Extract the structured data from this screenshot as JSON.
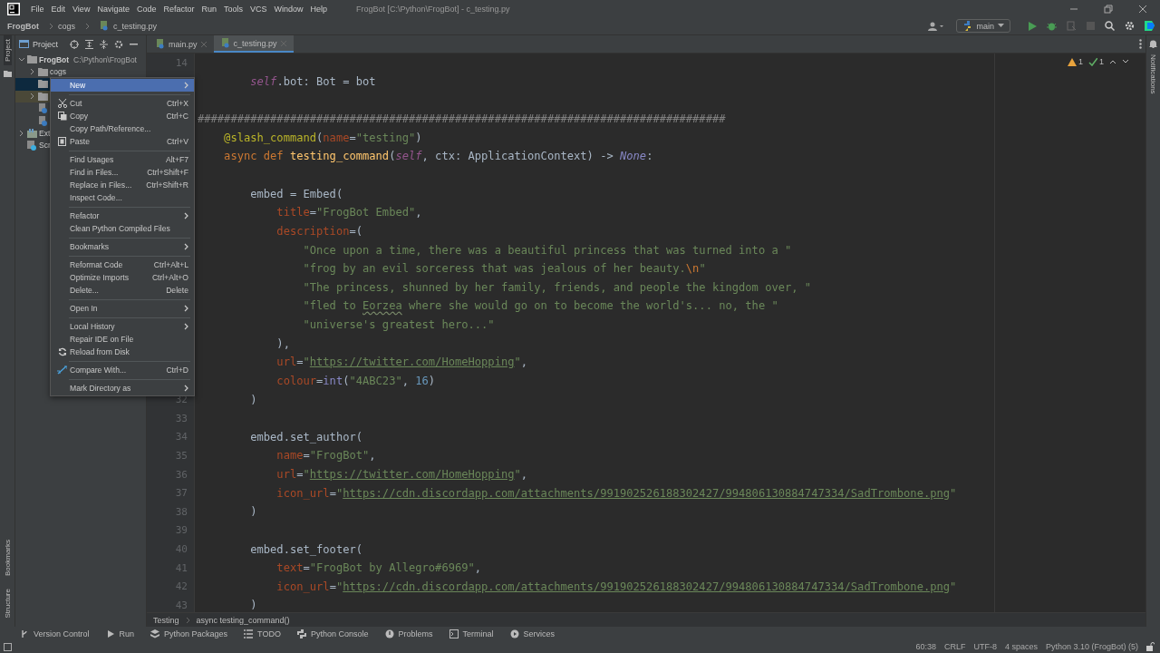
{
  "menu_bar": [
    "File",
    "Edit",
    "View",
    "Navigate",
    "Code",
    "Refactor",
    "Run",
    "Tools",
    "VCS",
    "Window",
    "Help"
  ],
  "window": {
    "title": "FrogBot [C:\\Python\\FrogBot] - c_testing.py"
  },
  "breadcrumbs": [
    {
      "label": "FrogBot",
      "kind": "project"
    },
    {
      "label": "cogs",
      "kind": "folder"
    },
    {
      "label": "c_testing.py",
      "kind": "file"
    }
  ],
  "run_config": {
    "label": "main"
  },
  "left_strip": {
    "top": [
      {
        "label": "Project",
        "selected": true
      }
    ],
    "bottom": [
      {
        "label": "Bookmarks",
        "selected": false
      },
      {
        "label": "Structure",
        "selected": false
      }
    ]
  },
  "right_strip": [
    {
      "label": "Notifications",
      "selected": false
    }
  ],
  "project_panel": {
    "title": "Project",
    "tree": [
      {
        "kind": "folder",
        "label": "FrogBot",
        "path": "C:\\Python\\FrogBot",
        "expanded": true,
        "selected": false,
        "children": [
          {
            "kind": "folder",
            "label": "cogs",
            "expanded": false,
            "selected": false
          },
          {
            "kind": "folder",
            "selected": true
          },
          {
            "kind": "folder",
            "expanded": false,
            "selected": false,
            "highlighted": true
          },
          {
            "kind": "file",
            "selected": false
          },
          {
            "kind": "file",
            "selected": false
          }
        ]
      },
      {
        "kind": "library",
        "label": "Ext",
        "expanded": false,
        "selected": false
      },
      {
        "kind": "scratch",
        "label": "Scr",
        "selected": false
      }
    ]
  },
  "tabs": [
    {
      "label": "main.py",
      "selected": false
    },
    {
      "label": "c_testing.py",
      "selected": true
    }
  ],
  "inspections": {
    "warnings": "1",
    "checks": "1"
  },
  "code_lines": [
    {
      "number": "14",
      "kind": "blank"
    },
    {
      "kind": "code",
      "tokens": [
        {
          "kind": "self",
          "text": "        self"
        },
        {
          "kind": "plain",
          "text": ".bot: Bot = bot"
        }
      ]
    },
    {
      "kind": "blank"
    },
    {
      "kind": "code",
      "tokens": [
        {
          "kind": "comment",
          "text": "################################################################################"
        }
      ]
    },
    {
      "kind": "code",
      "tokens": [
        {
          "kind": "deco",
          "text": "    @slash_command"
        },
        {
          "kind": "plain",
          "text": "("
        },
        {
          "kind": "param",
          "text": "name"
        },
        {
          "kind": "plain",
          "text": "="
        },
        {
          "kind": "str",
          "text": "\"testing\""
        },
        {
          "kind": "plain",
          "text": ")"
        }
      ]
    },
    {
      "kind": "code",
      "tokens": [
        {
          "kind": "kw",
          "text": "    async def "
        },
        {
          "kind": "func",
          "text": "testing_command"
        },
        {
          "kind": "plain",
          "text": "("
        },
        {
          "kind": "self",
          "text": "self"
        },
        {
          "kind": "plain",
          "text": ", ctx: ApplicationContext) -> "
        },
        {
          "kind": "none",
          "text": "None"
        },
        {
          "kind": "plain",
          "text": ":"
        }
      ]
    },
    {
      "kind": "blank"
    },
    {
      "kind": "code",
      "tokens": [
        {
          "kind": "plain",
          "text": "        embed = "
        },
        {
          "kind": "cls",
          "text": "Embed"
        },
        {
          "kind": "plain",
          "text": "("
        }
      ]
    },
    {
      "kind": "code",
      "tokens": [
        {
          "kind": "param",
          "text": "            title"
        },
        {
          "kind": "plain",
          "text": "="
        },
        {
          "kind": "str",
          "text": "\"FrogBot Embed\""
        },
        {
          "kind": "plain",
          "text": ","
        }
      ]
    },
    {
      "kind": "code",
      "tokens": [
        {
          "kind": "param",
          "text": "            description"
        },
        {
          "kind": "plain",
          "text": "=("
        }
      ]
    },
    {
      "kind": "code",
      "tokens": [
        {
          "kind": "str",
          "text": "                \"Once upon a time, there was a beautiful princess that was turned into a \""
        }
      ]
    },
    {
      "kind": "code",
      "tokens": [
        {
          "kind": "str",
          "text": "                \"frog by an evil sorceress that was jealous of her beauty."
        },
        {
          "kind": "esc",
          "text": "\\n"
        },
        {
          "kind": "str",
          "text": "\""
        }
      ]
    },
    {
      "kind": "code",
      "tokens": [
        {
          "kind": "str",
          "text": "                \"The princess, shunned by her family, friends, and people the kingdom over, \""
        }
      ]
    },
    {
      "kind": "code",
      "tokens": [
        {
          "kind": "str",
          "text": "                \"fled to "
        },
        {
          "kind": "typo",
          "text": "Eorzea"
        },
        {
          "kind": "str",
          "text": " where she would go on to become the world's... no, the \""
        }
      ]
    },
    {
      "kind": "code",
      "tokens": [
        {
          "kind": "str",
          "text": "                \"universe's greatest hero...\""
        }
      ]
    },
    {
      "kind": "code",
      "tokens": [
        {
          "kind": "plain",
          "text": "            ),"
        }
      ]
    },
    {
      "kind": "code",
      "tokens": [
        {
          "kind": "param",
          "text": "            url"
        },
        {
          "kind": "plain",
          "text": "="
        },
        {
          "kind": "str",
          "text": "\""
        },
        {
          "kind": "url",
          "text": "https://twitter.com/HomeHopping"
        },
        {
          "kind": "str",
          "text": "\""
        },
        {
          "kind": "plain",
          "text": ","
        }
      ]
    },
    {
      "kind": "code",
      "tokens": [
        {
          "kind": "param",
          "text": "            colour"
        },
        {
          "kind": "plain",
          "text": "="
        },
        {
          "kind": "builtin",
          "text": "int"
        },
        {
          "kind": "plain",
          "text": "("
        },
        {
          "kind": "str",
          "text": "\"4ABC23\""
        },
        {
          "kind": "plain",
          "text": ", "
        },
        {
          "kind": "number",
          "text": "16"
        },
        {
          "kind": "plain",
          "text": ")"
        }
      ]
    },
    {
      "number": "32",
      "kind": "code",
      "tokens": [
        {
          "kind": "plain",
          "text": "        )"
        }
      ]
    },
    {
      "number": "33",
      "kind": "blank"
    },
    {
      "number": "34",
      "kind": "code",
      "tokens": [
        {
          "kind": "plain",
          "text": "        embed.set_author("
        }
      ]
    },
    {
      "number": "35",
      "kind": "code",
      "tokens": [
        {
          "kind": "param",
          "text": "            name"
        },
        {
          "kind": "plain",
          "text": "="
        },
        {
          "kind": "str",
          "text": "\"FrogBot\""
        },
        {
          "kind": "plain",
          "text": ","
        }
      ]
    },
    {
      "number": "36",
      "kind": "code",
      "tokens": [
        {
          "kind": "param",
          "text": "            url"
        },
        {
          "kind": "plain",
          "text": "="
        },
        {
          "kind": "str",
          "text": "\""
        },
        {
          "kind": "url",
          "text": "https://twitter.com/HomeHopping"
        },
        {
          "kind": "str",
          "text": "\""
        },
        {
          "kind": "plain",
          "text": ","
        }
      ]
    },
    {
      "number": "37",
      "kind": "code",
      "tokens": [
        {
          "kind": "param",
          "text": "            icon_url"
        },
        {
          "kind": "plain",
          "text": "="
        },
        {
          "kind": "str",
          "text": "\""
        },
        {
          "kind": "url",
          "text": "https://cdn.discordapp.com/attachments/991902526188302427/994806130884747334/SadTrombone.png"
        },
        {
          "kind": "str",
          "text": "\""
        }
      ]
    },
    {
      "number": "38",
      "kind": "code",
      "tokens": [
        {
          "kind": "plain",
          "text": "        )"
        }
      ]
    },
    {
      "number": "39",
      "kind": "blank"
    },
    {
      "number": "40",
      "kind": "code",
      "tokens": [
        {
          "kind": "plain",
          "text": "        embed.set_footer("
        }
      ]
    },
    {
      "number": "41",
      "kind": "code",
      "tokens": [
        {
          "kind": "param",
          "text": "            text"
        },
        {
          "kind": "plain",
          "text": "="
        },
        {
          "kind": "str",
          "text": "\"FrogBot by Allegro#6969\""
        },
        {
          "kind": "plain",
          "text": ","
        }
      ]
    },
    {
      "number": "42",
      "kind": "code",
      "tokens": [
        {
          "kind": "param",
          "text": "            icon_url"
        },
        {
          "kind": "plain",
          "text": "="
        },
        {
          "kind": "str",
          "text": "\""
        },
        {
          "kind": "url",
          "text": "https://cdn.discordapp.com/attachments/991902526188302427/994806130884747334/SadTrombone.png"
        },
        {
          "kind": "str",
          "text": "\""
        }
      ]
    },
    {
      "number": "43",
      "kind": "code",
      "tokens": [
        {
          "kind": "plain",
          "text": "        )"
        }
      ]
    }
  ],
  "editor_breadcrumbs": [
    "Testing",
    "async testing_command()"
  ],
  "context_menu": [
    {
      "kind": "item",
      "label": "New",
      "submenu": true,
      "selected": true
    },
    {
      "kind": "separator"
    },
    {
      "kind": "item",
      "label": "Cut",
      "shortcut": "Ctrl+X",
      "selected": false
    },
    {
      "kind": "item",
      "label": "Copy",
      "shortcut": "Ctrl+C",
      "selected": false
    },
    {
      "kind": "item",
      "label": "Copy Path/Reference...",
      "selected": false
    },
    {
      "kind": "item",
      "label": "Paste",
      "shortcut": "Ctrl+V",
      "selected": false
    },
    {
      "kind": "separator"
    },
    {
      "kind": "item",
      "label": "Find Usages",
      "shortcut": "Alt+F7",
      "selected": false
    },
    {
      "kind": "item",
      "label": "Find in Files...",
      "shortcut": "Ctrl+Shift+F",
      "selected": false
    },
    {
      "kind": "item",
      "label": "Replace in Files...",
      "shortcut": "Ctrl+Shift+R",
      "selected": false
    },
    {
      "kind": "item",
      "label": "Inspect Code...",
      "selected": false
    },
    {
      "kind": "separator"
    },
    {
      "kind": "item",
      "label": "Refactor",
      "submenu": true,
      "selected": false
    },
    {
      "kind": "item",
      "label": "Clean Python Compiled Files",
      "selected": false
    },
    {
      "kind": "separator"
    },
    {
      "kind": "item",
      "label": "Bookmarks",
      "submenu": true,
      "selected": false
    },
    {
      "kind": "separator"
    },
    {
      "kind": "item",
      "label": "Reformat Code",
      "shortcut": "Ctrl+Alt+L",
      "selected": false
    },
    {
      "kind": "item",
      "label": "Optimize Imports",
      "shortcut": "Ctrl+Alt+O",
      "selected": false
    },
    {
      "kind": "item",
      "label": "Delete...",
      "shortcut": "Delete",
      "selected": false
    },
    {
      "kind": "separator"
    },
    {
      "kind": "item",
      "label": "Open In",
      "submenu": true,
      "selected": false
    },
    {
      "kind": "separator"
    },
    {
      "kind": "item",
      "label": "Local History",
      "submenu": true,
      "selected": false
    },
    {
      "kind": "item",
      "label": "Repair IDE on File",
      "selected": false
    },
    {
      "kind": "item",
      "label": "Reload from Disk",
      "selected": false
    },
    {
      "kind": "separator"
    },
    {
      "kind": "item",
      "label": "Compare With...",
      "shortcut": "Ctrl+D",
      "selected": false
    },
    {
      "kind": "separator"
    },
    {
      "kind": "item",
      "label": "Mark Directory as",
      "submenu": true,
      "selected": false
    }
  ],
  "tool_windows": [
    "Version Control",
    "Run",
    "Python Packages",
    "TODO",
    "Python Console",
    "Problems",
    "Terminal",
    "Services"
  ],
  "status_bar": [
    "60:38",
    "CRLF",
    "UTF-8",
    "4 spaces",
    "Python 3.10 (FrogBot) (5)"
  ]
}
